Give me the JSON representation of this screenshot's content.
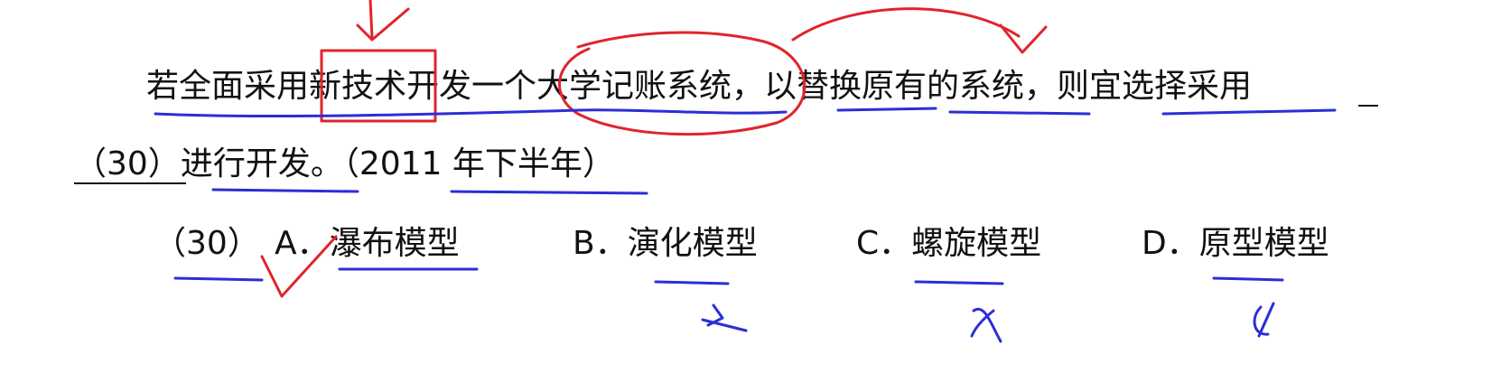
{
  "question": {
    "line1": "若全面采用新技术开发一个大学记账系统，以替换原有的系统，则宜选择采用",
    "blank_label": "（30）",
    "line2_rest": "进行开发。",
    "source": "（2011 年下半年）"
  },
  "options": {
    "number": "（30）",
    "a": "A．瀑布模型",
    "b": "B．演化模型",
    "c": "C．螺旋模型",
    "d": "D．原型模型"
  },
  "annotation_colors": {
    "red": "#e0242c",
    "blue": "#2b2ed6"
  }
}
